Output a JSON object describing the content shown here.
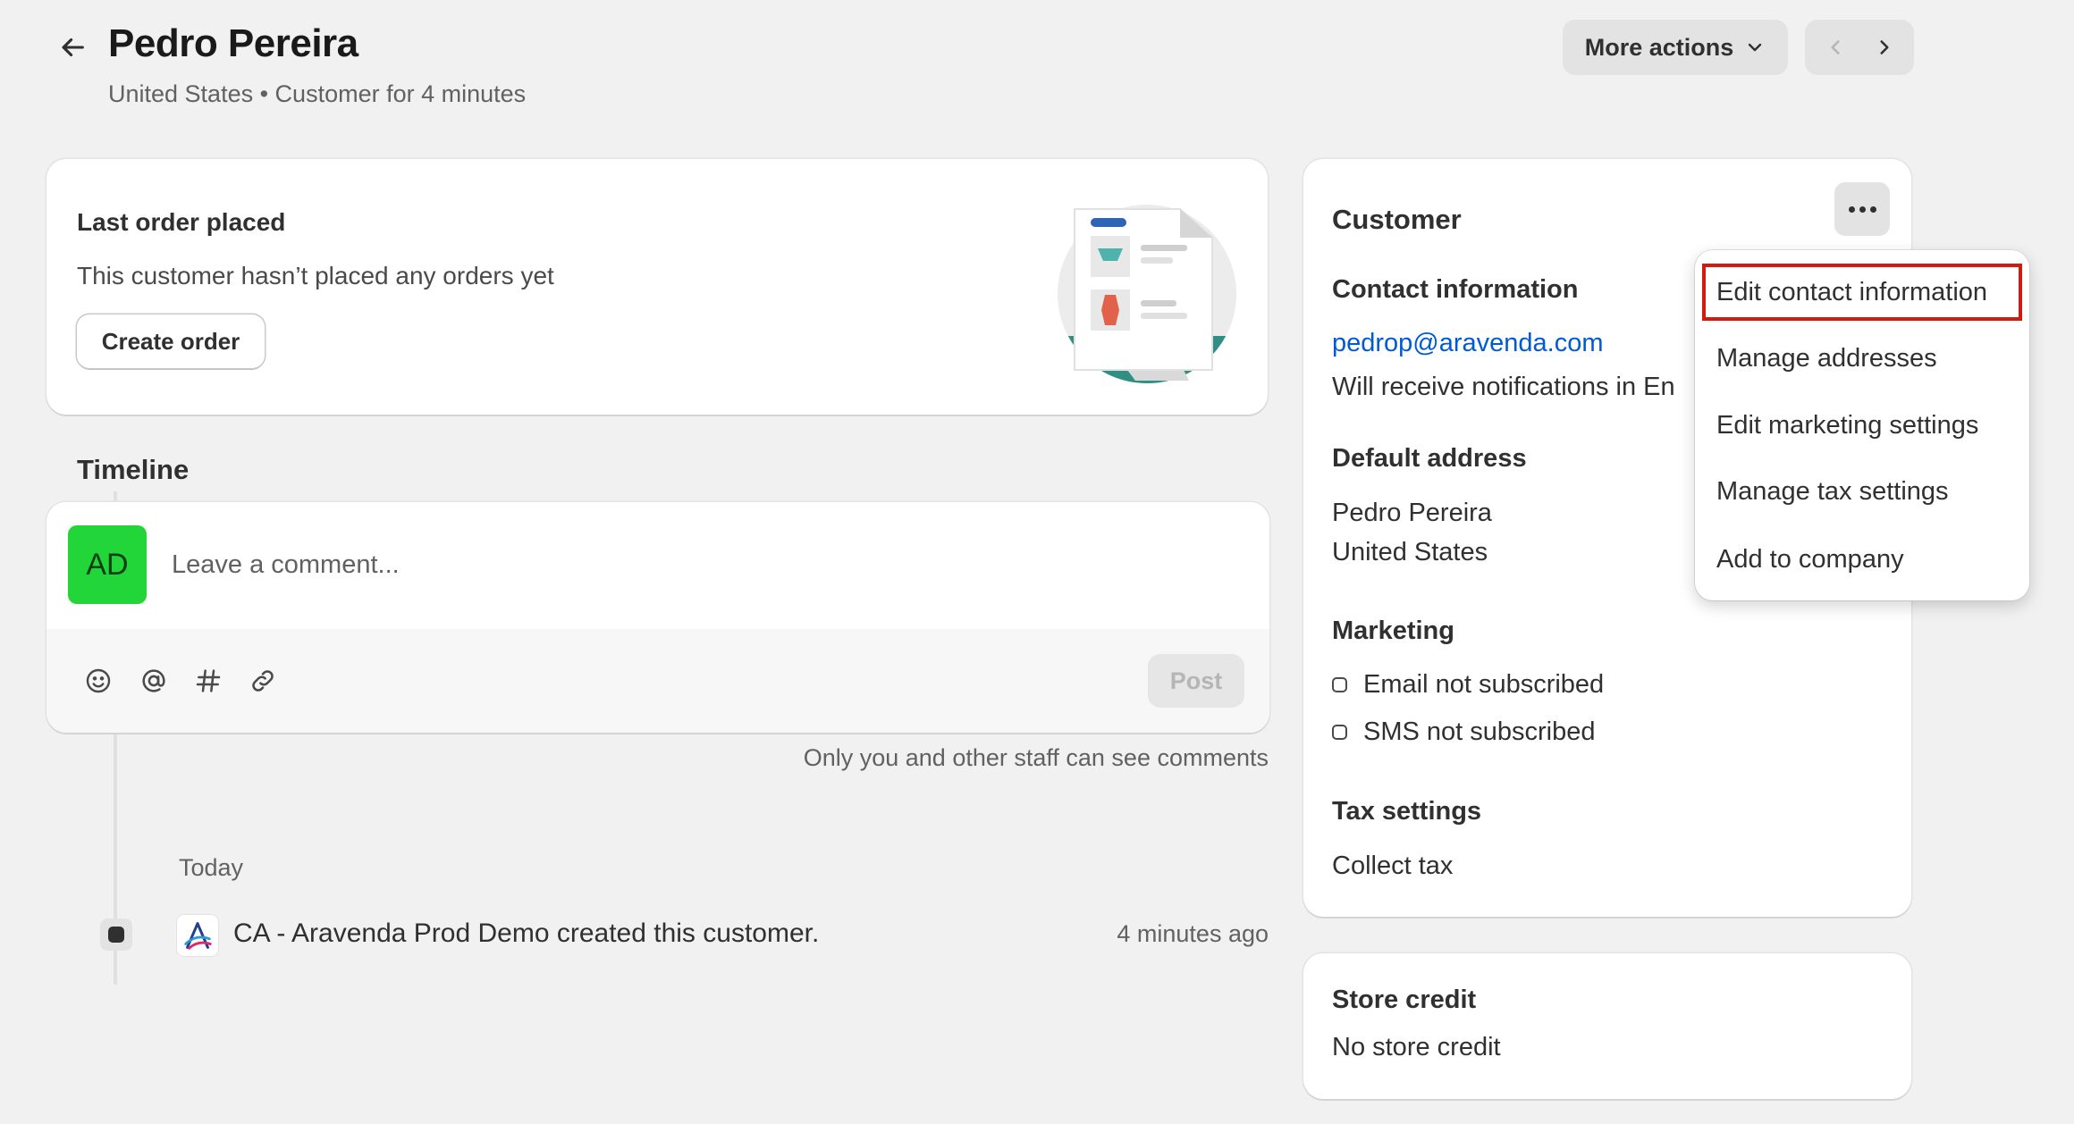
{
  "header": {
    "title": "Pedro Pereira",
    "subtitle": "United States • Customer for 4 minutes",
    "more_actions_label": "More actions"
  },
  "last_order": {
    "title": "Last order placed",
    "text": "This customer hasn’t placed any orders yet",
    "create_order_label": "Create order"
  },
  "timeline": {
    "title": "Timeline",
    "avatar_initials": "AD",
    "comment_placeholder": "Leave a comment...",
    "post_label": "Post",
    "staff_note": "Only you and other staff can see comments",
    "day_label": "Today",
    "events": [
      {
        "text": "CA - Aravenda Prod Demo created this customer.",
        "time": "4 minutes ago"
      }
    ]
  },
  "customer": {
    "title": "Customer",
    "contact_heading": "Contact information",
    "email": "pedrop@aravenda.com",
    "notifications_text": "Will receive notifications in En",
    "address_heading": "Default address",
    "address_name": "Pedro Pereira",
    "address_country": "United States",
    "marketing_heading": "Marketing",
    "email_marketing": "Email not subscribed",
    "sms_marketing": "SMS not subscribed",
    "tax_heading": "Tax settings",
    "tax_value": "Collect tax"
  },
  "store_credit": {
    "title": "Store credit",
    "value": "No store credit"
  },
  "menu": {
    "items": [
      "Edit contact information",
      "Manage addresses",
      "Edit marketing settings",
      "Manage tax settings",
      "Add to company"
    ],
    "highlighted_index": 0,
    "highlight_color": "#d21a0e"
  },
  "colors": {
    "background": "#f1f1f1",
    "link": "#005bd3",
    "avatar": "#22d63a"
  }
}
